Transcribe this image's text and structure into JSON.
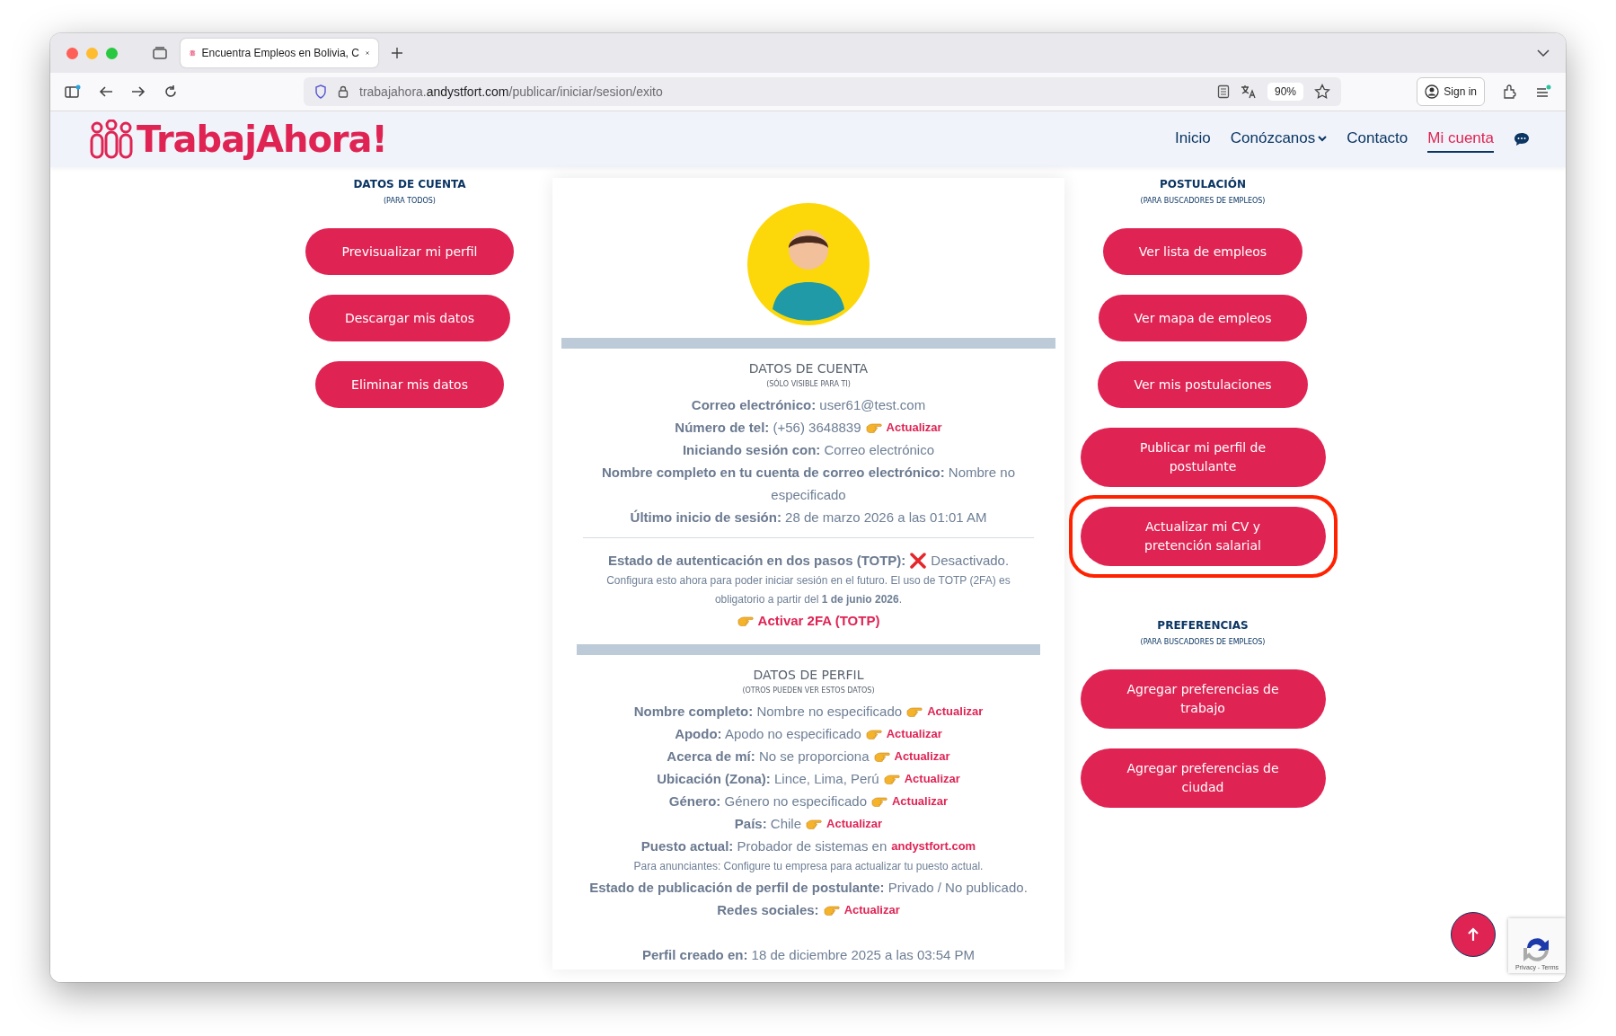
{
  "browser": {
    "tab_title": "Encuentra Empleos en Bolivia, C",
    "url": {
      "subdomain": "trabajahora.",
      "domain": "andystfort.com",
      "path": "/publicar/iniciar/sesion/exito"
    },
    "zoom": "90%",
    "sign_in": "Sign in"
  },
  "site": {
    "logo": "TrabajAhora!",
    "nav": [
      {
        "label": "Inicio",
        "selected": false,
        "dropdown": false
      },
      {
        "label": "Conózcanos",
        "selected": false,
        "dropdown": true
      },
      {
        "label": "Contacto",
        "selected": false,
        "dropdown": false
      },
      {
        "label": "Mi cuenta",
        "selected": true,
        "dropdown": false
      }
    ]
  },
  "left": [
    {
      "title": "DATOS DE CUENTA",
      "subtitle": "(PARA TODOS)",
      "buttons": [
        {
          "label": "Previsualizar mi perfil",
          "highlighted": false
        },
        {
          "label": "Descargar mis datos",
          "highlighted": false
        },
        {
          "label": "Eliminar mis datos",
          "highlighted": false
        }
      ]
    }
  ],
  "account": {
    "title": "DATOS DE CUENTA",
    "subtitle": "(SÓLO VISIBLE PARA TI)",
    "rows": [
      {
        "label": "Correo electrónico:",
        "value": "user61@test.com"
      },
      {
        "label": "Número de tel:",
        "value": "(+56) 3648839",
        "action": "Actualizar"
      },
      {
        "label": "Iniciando sesión con:",
        "value": "Correo electrónico"
      },
      {
        "label": "Nombre completo en tu cuenta de correo electrónico:",
        "value": "Nombre no especificado"
      },
      {
        "label": "Último inicio de sesión:",
        "value": "28 de marzo 2026 a las 01:01 AM"
      }
    ],
    "twofa": {
      "label": "Estado de autenticación en dos pasos (TOTP):",
      "enabled": false,
      "status": "Desactivado.",
      "note": "Configura esto ahora para poder iniciar sesión en el futuro. El uso de TOTP (2FA) es obligatorio a partir del **1 de junio 2026**.",
      "action": "Activar 2FA (TOTP)"
    }
  },
  "profile": {
    "title": "DATOS DE PERFIL",
    "subtitle": "(OTROS PUEDEN VER ESTOS DATOS)",
    "rows": [
      {
        "kind": "field",
        "label": "Nombre completo:",
        "value": "Nombre no especificado",
        "action": "Actualizar"
      },
      {
        "kind": "field",
        "label": "Apodo:",
        "value": "Apodo no especificado",
        "action": "Actualizar"
      },
      {
        "kind": "field",
        "label": "Acerca de mí:",
        "value": "No se proporciona",
        "action": "Actualizar"
      },
      {
        "kind": "field",
        "label": "Ubicación (Zona):",
        "value": "Lince, Lima, Perú",
        "action": "Actualizar"
      },
      {
        "kind": "field",
        "label": "Género:",
        "value": "Género no especificado",
        "action": "Actualizar"
      },
      {
        "kind": "field",
        "label": "País:",
        "value": "Chile",
        "action": "Actualizar"
      },
      {
        "kind": "link",
        "label": "Puesto actual:",
        "value": "Probador de sistemas en",
        "link": "andystfort.com"
      },
      {
        "kind": "note",
        "text": "Para anunciantes: Configure tu empresa para actualizar tu puesto actual."
      },
      {
        "kind": "field",
        "label": "Estado de publicación de perfil de postulante:",
        "value": "Privado / No publicado."
      },
      {
        "kind": "field",
        "label": "Redes sociales:",
        "action": "Actualizar"
      },
      {
        "kind": "footer",
        "label": "Perfil creado en:",
        "value": "18 de diciembre 2025 a las 03:54 PM"
      }
    ]
  },
  "right": [
    {
      "title": "POSTULACIÓN",
      "subtitle": "(PARA BUSCADORES DE EMPLEOS)",
      "buttons": [
        {
          "label": "Ver lista de empleos",
          "highlighted": false
        },
        {
          "label": "Ver mapa de empleos",
          "highlighted": false
        },
        {
          "label": "Ver mis postulaciones",
          "highlighted": false
        },
        {
          "label": "Publicar mi perfil de postulante",
          "highlighted": false
        },
        {
          "label": "Actualizar mi CV y pretención salarial",
          "highlighted": true
        }
      ]
    },
    {
      "title": "PREFERENCIAS",
      "subtitle": "(PARA BUSCADORES DE EMPLEOS)",
      "buttons": [
        {
          "label": "Agregar preferencias de trabajo",
          "highlighted": false
        },
        {
          "label": "Agregar preferencias de ciudad",
          "highlighted": false
        }
      ]
    }
  ],
  "recaptcha": "Privacy - Terms"
}
